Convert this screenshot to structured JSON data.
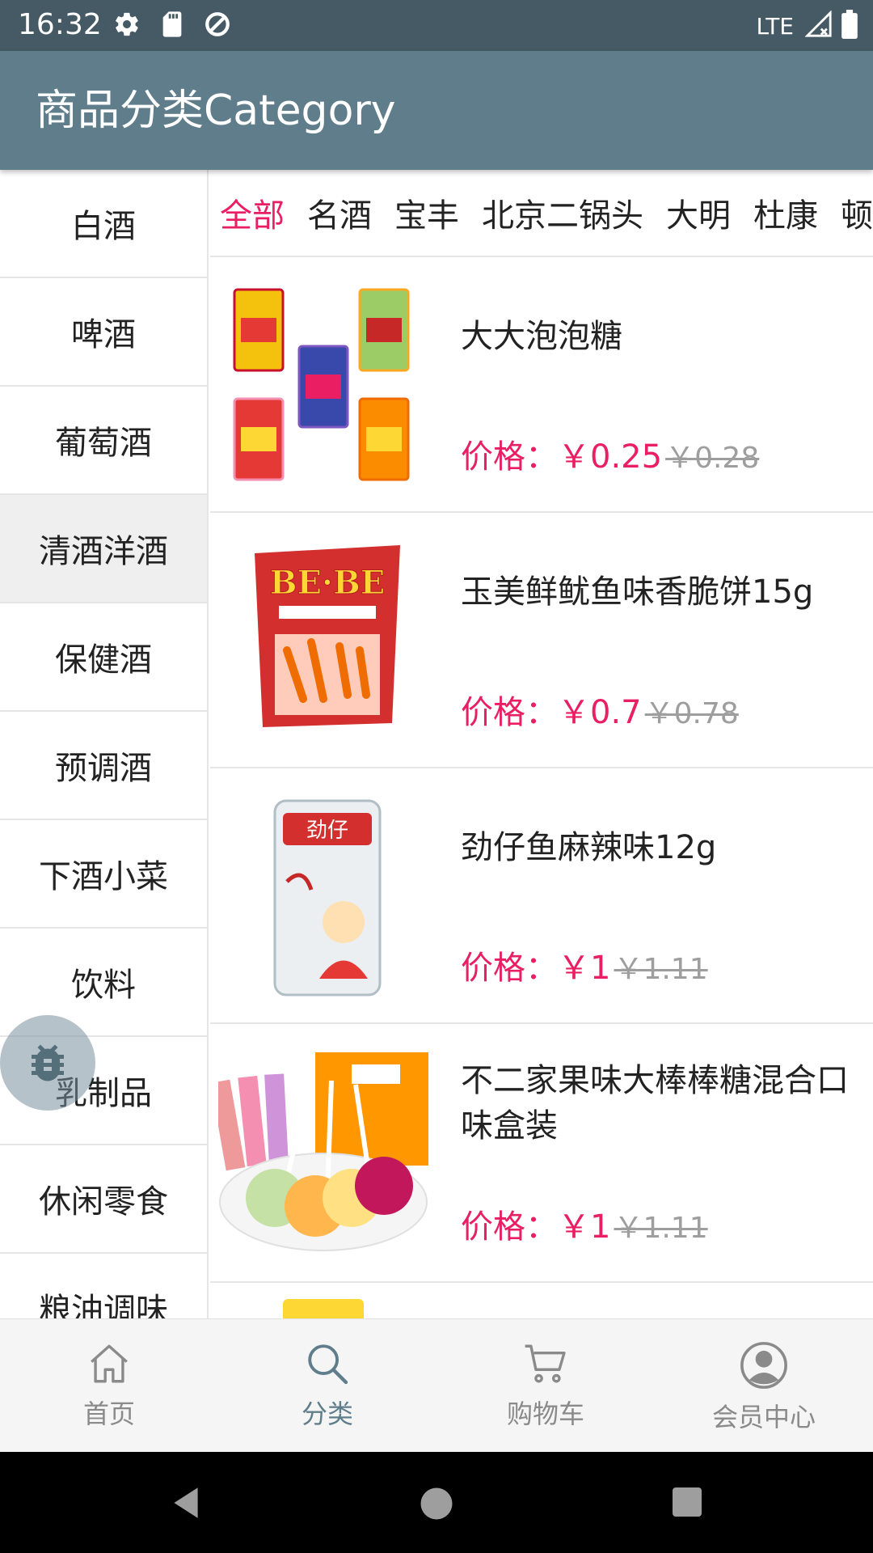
{
  "status_bar": {
    "time": "16:32",
    "network": "LTE",
    "icons_left": [
      "gear-icon",
      "sd-card-icon",
      "data-saver-icon"
    ],
    "icons_right": [
      "signal-icon",
      "battery-icon"
    ]
  },
  "app_bar": {
    "title": "商品分类Category"
  },
  "categories": [
    {
      "label": "白酒"
    },
    {
      "label": "啤酒"
    },
    {
      "label": "葡萄酒"
    },
    {
      "label": "清酒洋酒",
      "active": true
    },
    {
      "label": "保健酒"
    },
    {
      "label": "预调酒"
    },
    {
      "label": "下酒小菜"
    },
    {
      "label": "饮料"
    },
    {
      "label": "乳制品"
    },
    {
      "label": "休闲零食"
    },
    {
      "label": "粮油调味"
    }
  ],
  "subtabs": [
    {
      "label": "全部",
      "active": true
    },
    {
      "label": "名酒"
    },
    {
      "label": "宝丰"
    },
    {
      "label": "北京二锅头"
    },
    {
      "label": "大明"
    },
    {
      "label": "杜康"
    },
    {
      "label": "顿"
    }
  ],
  "price_label": "价格：",
  "products": [
    {
      "name": "大大泡泡糖",
      "price": "￥0.25",
      "old_price": "￥0.28",
      "image": "bubble-gum-boxes"
    },
    {
      "name": "玉美鲜鱿鱼味香脆饼15g",
      "price": "￥0.7",
      "old_price": "￥0.78",
      "image": "rice-cracker-bag",
      "image_text": "BE·BE"
    },
    {
      "name": "劲仔鱼麻辣味12g",
      "price": "￥1",
      "old_price": "￥1.11",
      "image": "fish-snack-pack",
      "image_text": "劲仔"
    },
    {
      "name": "不二家果味大棒棒糖混合口味盒装",
      "price": "￥1",
      "old_price": "￥1.11",
      "image": "lollipop-plate"
    }
  ],
  "bottom_nav": [
    {
      "label": "首页",
      "icon": "home-icon"
    },
    {
      "label": "分类",
      "icon": "search-icon",
      "active": true
    },
    {
      "label": "购物车",
      "icon": "cart-icon"
    },
    {
      "label": "会员中心",
      "icon": "account-icon"
    }
  ],
  "colors": {
    "status_bar": "#455a64",
    "app_bar": "#607d8b",
    "accent": "#e91e63",
    "old_price": "#9e9e9e",
    "nav_active": "#607d8b"
  }
}
